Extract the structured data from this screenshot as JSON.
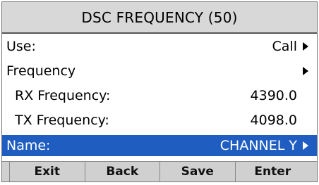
{
  "title": "DSC FREQUENCY (50)",
  "rows": [
    {
      "label": "Use:",
      "value": "Call"
    },
    {
      "label": "Frequency",
      "value": ""
    },
    {
      "label": "RX Frequency:",
      "value": "4390.0"
    },
    {
      "label": "TX Frequency:",
      "value": "4098.0"
    },
    {
      "label": "Name:",
      "value": "CHANNEL Y"
    }
  ],
  "softkeys": [
    "Exit",
    "Back",
    "Save",
    "Enter"
  ],
  "colors": {
    "selection": "#1f5dc1",
    "title_bg": "#d8d8d8"
  },
  "icons": {
    "submenu": "triangle-right-icon"
  }
}
